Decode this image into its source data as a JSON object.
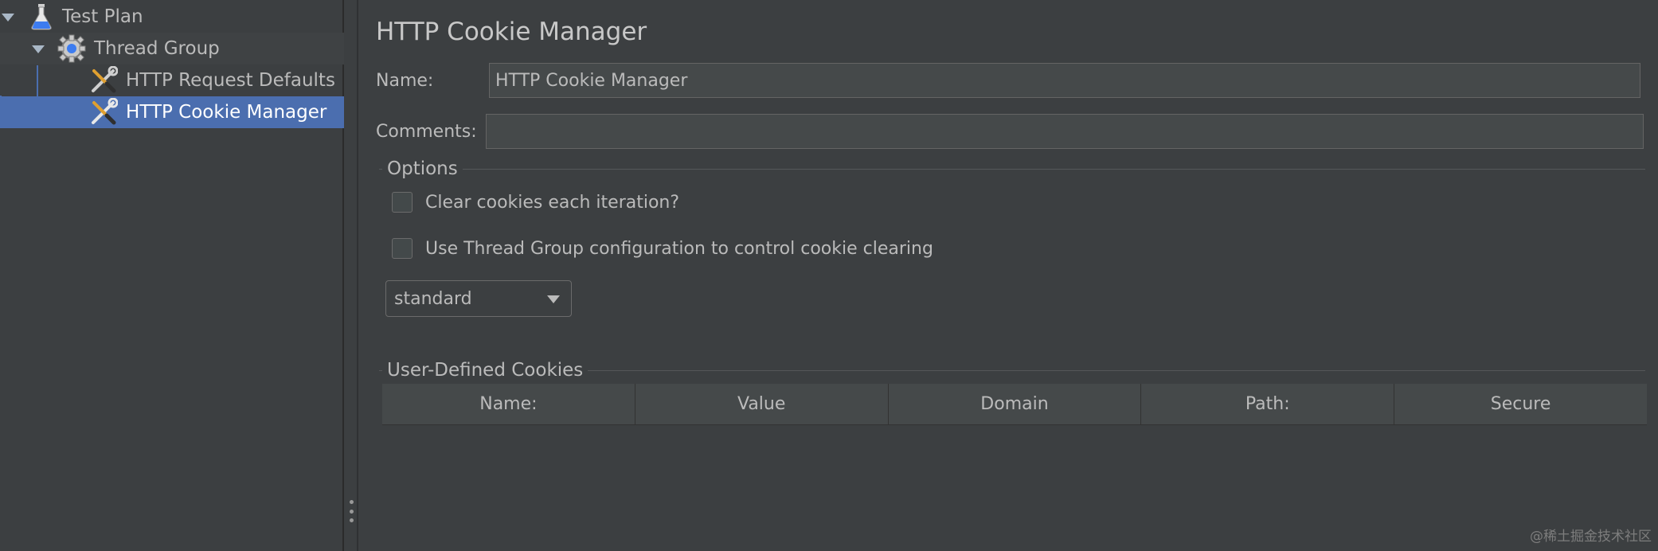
{
  "tree": {
    "items": [
      {
        "label": "Test Plan",
        "icon": "flask-icon"
      },
      {
        "label": "Thread Group",
        "icon": "gear-icon"
      },
      {
        "label": "HTTP Request Defaults",
        "icon": "wrench-icon"
      },
      {
        "label": "HTTP Cookie Manager",
        "icon": "wrench-icon",
        "selected": true
      }
    ]
  },
  "panel": {
    "title": "HTTP Cookie Manager",
    "name_label": "Name:",
    "name_value": "HTTP Cookie Manager",
    "comments_label": "Comments:",
    "comments_value": "",
    "options": {
      "title": "Options",
      "clear_cookies_label": "Clear cookies each iteration?",
      "clear_cookies_checked": false,
      "use_thread_group_label": "Use Thread Group configuration to control cookie clearing",
      "use_thread_group_checked": false,
      "policy_value": "standard"
    },
    "cookies": {
      "title": "User-Defined Cookies",
      "columns": [
        "Name:",
        "Value",
        "Domain",
        "Path:",
        "Secure"
      ]
    }
  },
  "watermark": "@稀土掘金技术社区",
  "colors": {
    "selection": "#4b6eaf",
    "background": "#3c3f41",
    "field": "#45494a"
  }
}
